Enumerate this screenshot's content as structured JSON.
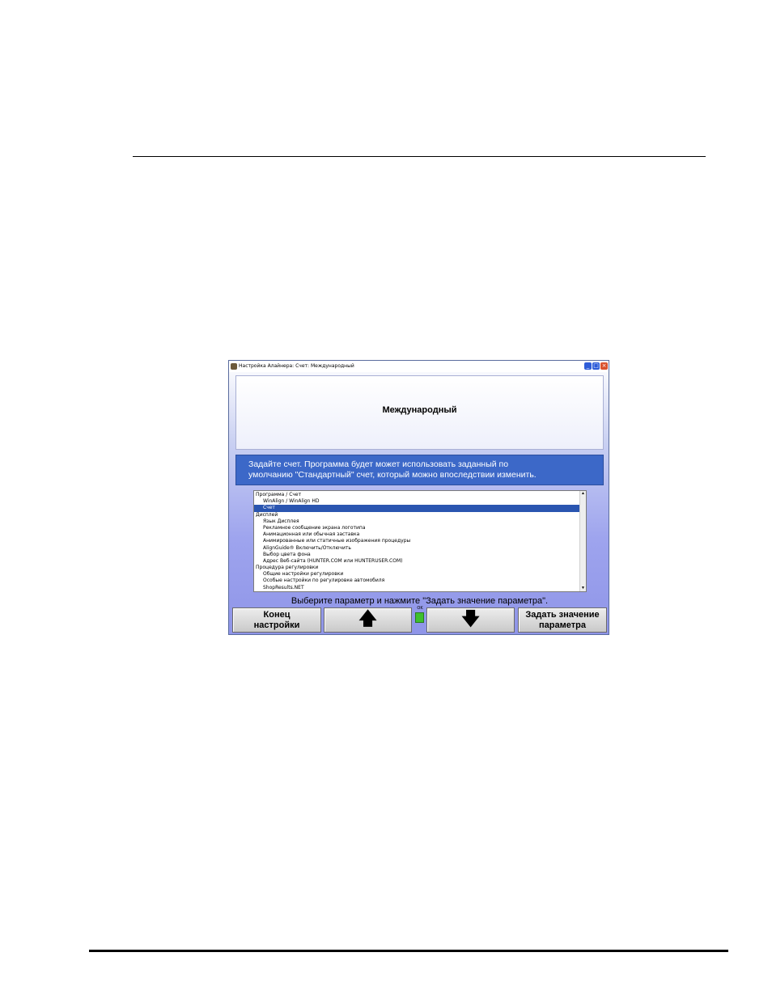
{
  "window": {
    "title": "Настройка Алайнера: Счет: Международный"
  },
  "header": {
    "title": "Международный"
  },
  "info": {
    "line1": "Задайте счет. Программа будет может использовать заданный по",
    "line2": "умолчанию \"Стандартный\" счет, который можно впоследствии изменить."
  },
  "list": {
    "items": [
      {
        "label": "Программа / Счет",
        "indent": false,
        "selected": false
      },
      {
        "label": "WinAlign / WinAlign HD",
        "indent": true,
        "selected": false
      },
      {
        "label": "Счет",
        "indent": true,
        "selected": true
      },
      {
        "label": "Дисплей",
        "indent": false,
        "selected": false
      },
      {
        "label": "Язык Дисплея",
        "indent": true,
        "selected": false
      },
      {
        "label": "Рекламное сообщение экрана логотипа",
        "indent": true,
        "selected": false
      },
      {
        "label": "Анимационная или обычная заставка",
        "indent": true,
        "selected": false
      },
      {
        "label": "Анимированные или статичные изображения процедуры",
        "indent": true,
        "selected": false
      },
      {
        "label": "AlignGuide® Включить/Отключить",
        "indent": true,
        "selected": false
      },
      {
        "label": "Выбор цвета фона",
        "indent": true,
        "selected": false
      },
      {
        "label": "Адрес Веб-сайта (HUNTER.COM или HUNTERUSER.COM)",
        "indent": true,
        "selected": false
      },
      {
        "label": "Процедура регулировки",
        "indent": false,
        "selected": false
      },
      {
        "label": "Общие настройки регулировки",
        "indent": true,
        "selected": false
      },
      {
        "label": "Особые настройки по регулировке автомобиля",
        "indent": true,
        "selected": false
      },
      {
        "label": "ShopResults.NET",
        "indent": true,
        "selected": false
      }
    ]
  },
  "instruction": "Выберите параметр и нажмите \"Задать значение параметра\".",
  "buttons": {
    "f1_line1": "Конец",
    "f1_line2": "настройки",
    "f2_glyph": "🡅",
    "f3_glyph": "🡇",
    "f4_line1": "Задать значение",
    "f4_line2": "параметра"
  },
  "indicator_label": "OK",
  "colors": {
    "info_bg": "#3c68c8",
    "selection": "#2a55b0",
    "indicator": "#3ec02e"
  }
}
